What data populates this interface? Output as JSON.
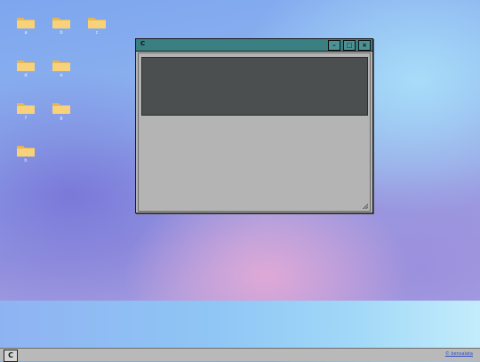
{
  "desktop": {
    "icons": [
      {
        "label": "a"
      },
      {
        "label": "b"
      },
      {
        "label": "c"
      },
      {
        "label": "d"
      },
      {
        "label": "e"
      },
      {
        "label": "f"
      },
      {
        "label": "g"
      },
      {
        "label": "h"
      }
    ]
  },
  "window": {
    "title": "C",
    "minimize_symbol": "–",
    "maximize_symbol": "□",
    "close_symbol": "×"
  },
  "taskbar": {
    "start_label": "C",
    "credit_text": "© bensalata"
  },
  "colors": {
    "titlebar": "#3a7f82",
    "window_bg": "#b4b4b4",
    "panel": "#4b4f50",
    "folder": "#f6c96a"
  },
  "icon_names": {
    "folder": "folder-icon",
    "grip": "resize-grip-icon"
  }
}
